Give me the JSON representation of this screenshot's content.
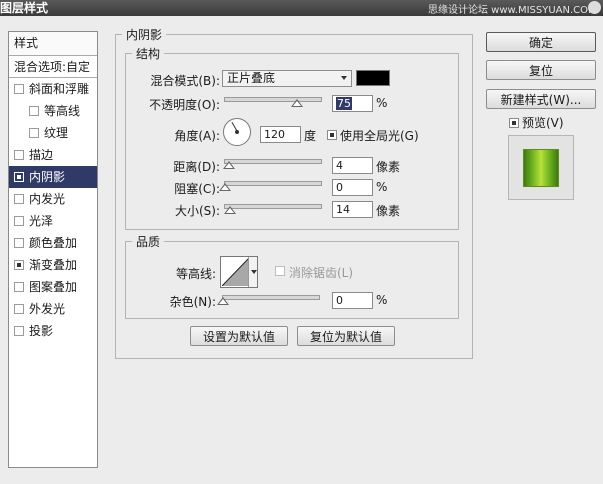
{
  "window": {
    "title": "图层样式",
    "watermark": "思缘设计论坛 www.MISSYUAN.COM"
  },
  "sidebar": {
    "header": "样式",
    "blend_options": "混合选项:自定",
    "items": [
      {
        "label": "斜面和浮雕",
        "checked": false,
        "sub": false,
        "selected": false
      },
      {
        "label": "等高线",
        "checked": false,
        "sub": true,
        "selected": false
      },
      {
        "label": "纹理",
        "checked": false,
        "sub": true,
        "selected": false
      },
      {
        "label": "描边",
        "checked": false,
        "sub": false,
        "selected": false
      },
      {
        "label": "内阴影",
        "checked": true,
        "sub": false,
        "selected": true
      },
      {
        "label": "内发光",
        "checked": false,
        "sub": false,
        "selected": false
      },
      {
        "label": "光泽",
        "checked": false,
        "sub": false,
        "selected": false
      },
      {
        "label": "颜色叠加",
        "checked": false,
        "sub": false,
        "selected": false
      },
      {
        "label": "渐变叠加",
        "checked": true,
        "sub": false,
        "selected": false
      },
      {
        "label": "图案叠加",
        "checked": false,
        "sub": false,
        "selected": false
      },
      {
        "label": "外发光",
        "checked": false,
        "sub": false,
        "selected": false
      },
      {
        "label": "投影",
        "checked": false,
        "sub": false,
        "selected": false
      }
    ]
  },
  "inner_shadow": {
    "title": "内阴影",
    "structure": {
      "title": "结构",
      "blend_mode_label": "混合模式(B):",
      "blend_mode_value": "正片叠底",
      "shadow_color": "#000000",
      "opacity_label": "不透明度(O):",
      "opacity_value": "75",
      "opacity_level": 0.75,
      "percent_sign": "%",
      "angle_label": "角度(A):",
      "angle_value": "120",
      "angle_unit": "度",
      "global_light_label": "使用全局光(G)",
      "global_light_checked": true,
      "distance_label": "距离(D):",
      "distance_value": "4",
      "distance_level": 0.04,
      "choke_label": "阻塞(C):",
      "choke_value": "0",
      "choke_level": 0.0,
      "size_label": "大小(S):",
      "size_value": "14",
      "size_level": 0.057,
      "pixels_unit": "像素"
    },
    "quality": {
      "title": "品质",
      "contour_label": "等高线:",
      "anti_alias_label": "消除锯齿(L)",
      "anti_alias_checked": false,
      "noise_label": "杂色(N):",
      "noise_value": "0",
      "noise_level": 0.0,
      "percent_sign": "%"
    },
    "set_default_label": "设置为默认值",
    "reset_default_label": "复位为默认值"
  },
  "buttons": {
    "ok": "确定",
    "reset": "复位",
    "new_style": "新建样式(W)...",
    "preview_label": "预览(V)",
    "preview_checked": true
  },
  "colors": {
    "selection": "#2f3a67",
    "preview_green": "#6fb221"
  }
}
